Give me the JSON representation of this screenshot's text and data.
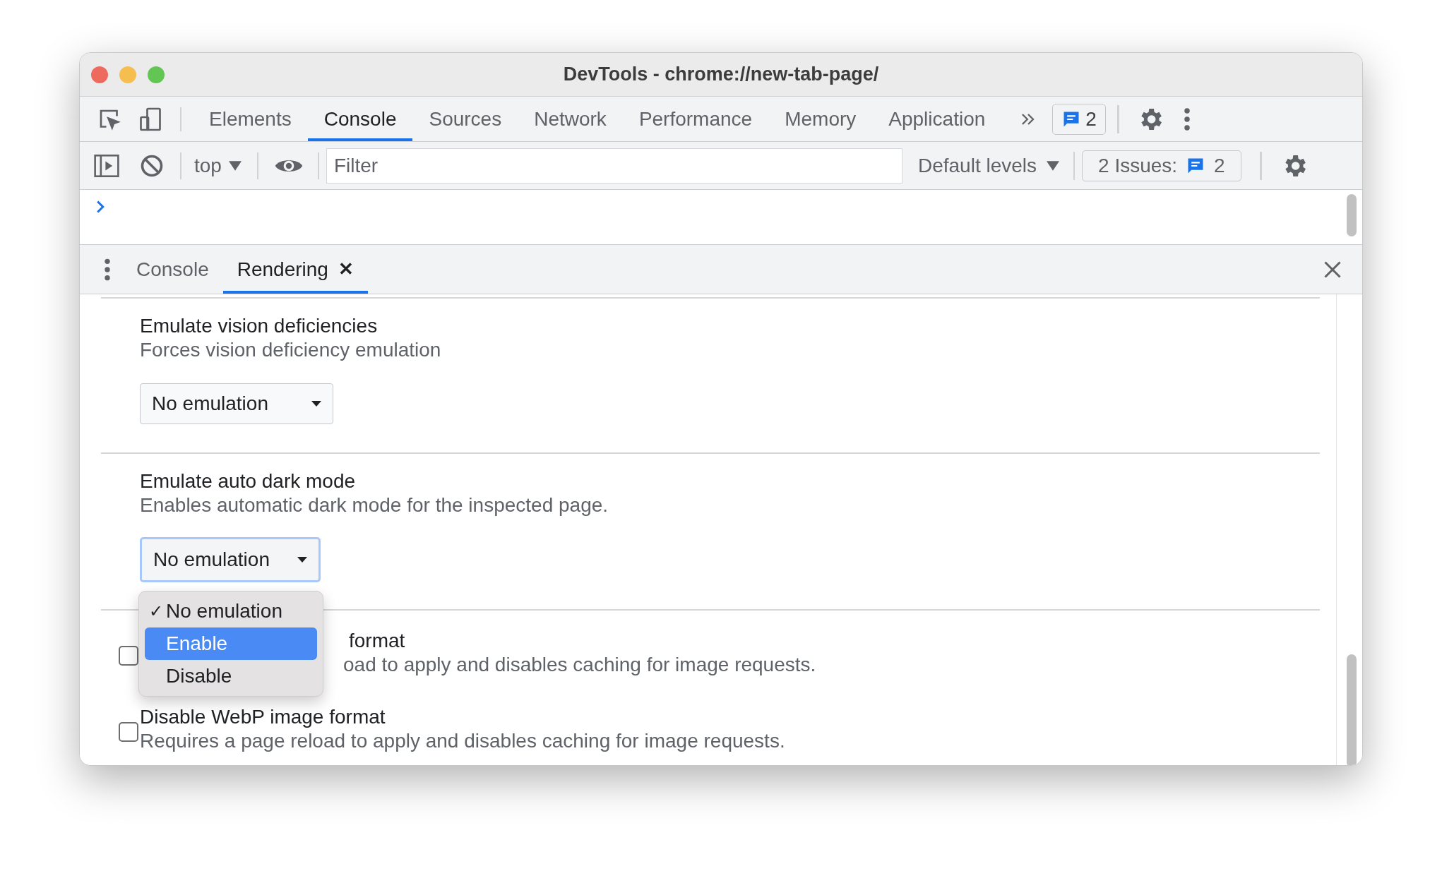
{
  "window": {
    "title": "DevTools - chrome://new-tab-page/"
  },
  "main_tabs": [
    {
      "label": "Elements",
      "selected": false
    },
    {
      "label": "Console",
      "selected": true
    },
    {
      "label": "Sources",
      "selected": false
    },
    {
      "label": "Network",
      "selected": false
    },
    {
      "label": "Performance",
      "selected": false
    },
    {
      "label": "Memory",
      "selected": false
    },
    {
      "label": "Application",
      "selected": false
    }
  ],
  "issues_badge": "2",
  "console_toolbar": {
    "context": "top",
    "filter_placeholder": "Filter",
    "levels": "Default levels",
    "issues_label": "2 Issues:",
    "issues_count": "2"
  },
  "drawer_tabs": [
    {
      "label": "Console",
      "selected": false,
      "closable": false
    },
    {
      "label": "Rendering",
      "selected": true,
      "closable": true
    }
  ],
  "close_glyph": "✕",
  "sections": [
    {
      "kind": "select",
      "title": "Emulate vision deficiencies",
      "description": "Forces vision deficiency emulation",
      "value": "No emulation",
      "focused": false
    },
    {
      "kind": "select",
      "title": "Emulate auto dark mode",
      "description": "Enables automatic dark mode for the inspected page.",
      "value": "No emulation",
      "focused": true
    },
    {
      "kind": "checkbox",
      "title": "format",
      "description": "oad to apply and disables caching for image requests.",
      "checked": false,
      "partly_hidden": true
    },
    {
      "kind": "checkbox",
      "title": "Disable WebP image format",
      "description": "Requires a page reload to apply and disables caching for image requests.",
      "checked": false,
      "partly_hidden": false
    }
  ],
  "dropdown_menu": {
    "options": [
      {
        "label": "No emulation",
        "checked": true,
        "highlighted": false
      },
      {
        "label": "Enable",
        "checked": false,
        "highlighted": true
      },
      {
        "label": "Disable",
        "checked": false,
        "highlighted": false
      }
    ]
  },
  "check_glyph": "✓"
}
